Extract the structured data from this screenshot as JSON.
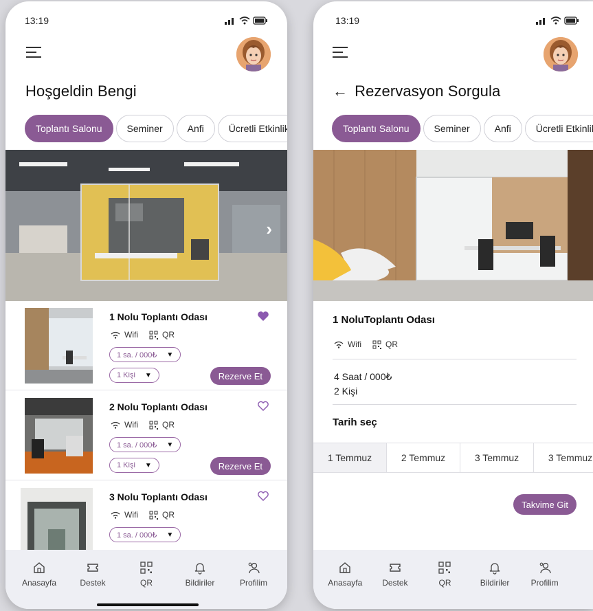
{
  "time": "13:19",
  "colors": {
    "accent": "#8a5a94",
    "tabbar": "#eeeff4"
  },
  "categories": [
    "Toplantı Salonu",
    "Seminer",
    "Anfi",
    "Ücretli Etkinlik"
  ],
  "tabs": [
    {
      "label": "Anasayfa",
      "icon": "home-icon"
    },
    {
      "label": "Destek",
      "icon": "ticket-icon"
    },
    {
      "label": "QR",
      "icon": "qr-icon"
    },
    {
      "label": "Bildiriler",
      "icon": "bell-icon"
    },
    {
      "label": "Profilim",
      "icon": "users-icon"
    }
  ],
  "home": {
    "title": "Hoşgeldin Bengi",
    "rooms": [
      {
        "name": "1 Nolu Toplantı Odası",
        "wifi": "Wifi",
        "qr": "QR",
        "price": "1 sa. / 000₺",
        "people": "1 Kişi",
        "reserve": "Rezerve Et",
        "favorite": true
      },
      {
        "name": "2 Nolu Toplantı Odası",
        "wifi": "Wifi",
        "qr": "QR",
        "price": "1 sa. / 000₺",
        "people": "1 Kişi",
        "reserve": "Rezerve Et",
        "favorite": false
      },
      {
        "name": "3 Nolu Toplantı Odası",
        "wifi": "Wifi",
        "qr": "QR",
        "price": "1 sa. / 000₺",
        "people": "",
        "reserve": "",
        "favorite": false
      }
    ]
  },
  "reservation": {
    "title": "Rezervasyon Sorgula",
    "room_name": "1 NoluToplantı Odası",
    "wifi": "Wifi",
    "qr": "QR",
    "duration": "4 Saat / 000₺",
    "people": "2 Kişi",
    "date_label": "Tarih seç",
    "dates": [
      "1 Temmuz",
      "2 Temmuz",
      "3 Temmuz",
      "3 Temmuz"
    ],
    "calendar_button": "Takvime Git"
  }
}
